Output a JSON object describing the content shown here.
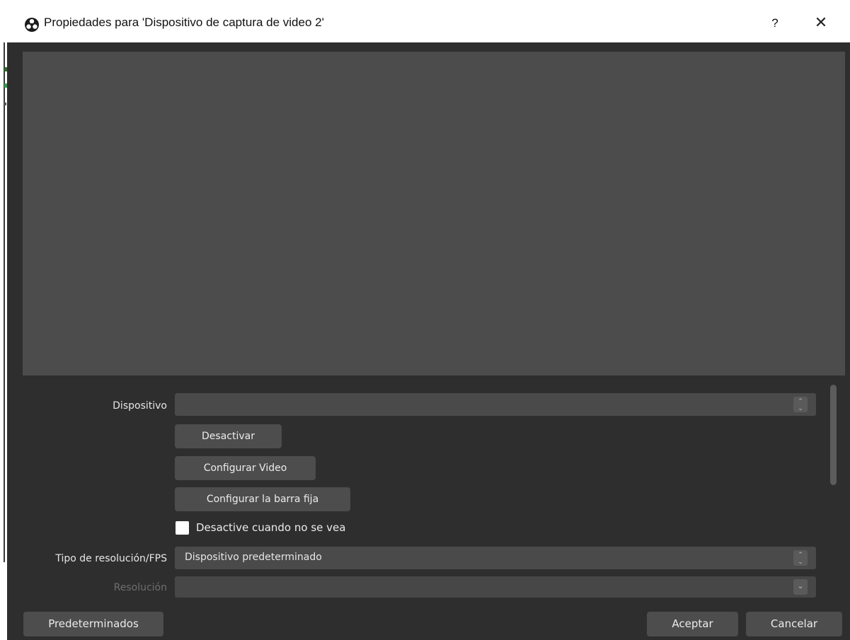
{
  "window": {
    "title": "Propiedades para 'Dispositivo de captura de video 2'",
    "help_label": "?",
    "close_label": "✕"
  },
  "properties": {
    "device": {
      "label": "Dispositivo",
      "value": ""
    },
    "buttons": {
      "deactivate": "Desactivar",
      "configure_video": "Configurar Video",
      "configure_crossbar": "Configurar la barra fija"
    },
    "deactivate_when_hidden": {
      "label": "Desactive cuando no se vea",
      "checked": false
    },
    "resolution_type": {
      "label": "Tipo de resolución/FPS",
      "value": "Dispositivo predeterminado"
    },
    "resolution": {
      "label": "Resolución",
      "value": "",
      "enabled": false
    }
  },
  "footer": {
    "defaults_label": "Predeterminados",
    "accept_label": "Aceptar",
    "cancel_label": "Cancelar"
  },
  "icons": {
    "app": "obs-logo-icon",
    "spin_arrows": "up-down-arrows-icon",
    "dropdown": "chevron-down-icon"
  },
  "colors": {
    "dialog_bg": "#2e2e2e",
    "preview_bg": "#4c4c4c",
    "control_bg": "#4a4a4a",
    "text": "#e6e6e6",
    "disabled_text": "#6e6e6e"
  }
}
